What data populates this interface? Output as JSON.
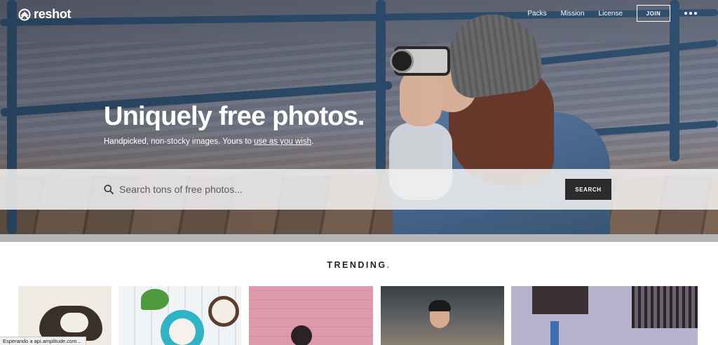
{
  "brand": {
    "name": "reshot",
    "logo_icon": "reshot-logo-icon"
  },
  "nav": {
    "links": [
      "Packs",
      "Mission",
      "License"
    ],
    "join_label": "JOIN",
    "more_icon": "more-dots-icon"
  },
  "hero": {
    "headline": "Uniquely free photos.",
    "subline_prefix": "Handpicked, non-stocky images. Yours to ",
    "subline_link": "use as you wish",
    "subline_suffix": "."
  },
  "search": {
    "placeholder": "Search tons of free photos...",
    "button_label": "SEARCH",
    "icon": "search-icon"
  },
  "trending": {
    "title": "TRENDING",
    "title_dot": ".",
    "accent_color": "#e0502f"
  },
  "thumbnails": [
    {
      "subject": "cat sleeping"
    },
    {
      "subject": "coconut and plant flatlay"
    },
    {
      "subject": "person by pink wall"
    },
    {
      "subject": "man in cafe"
    },
    {
      "subject": "purple building"
    }
  ],
  "status_bar": {
    "text": "Esperando a api.amplitude.com..."
  }
}
